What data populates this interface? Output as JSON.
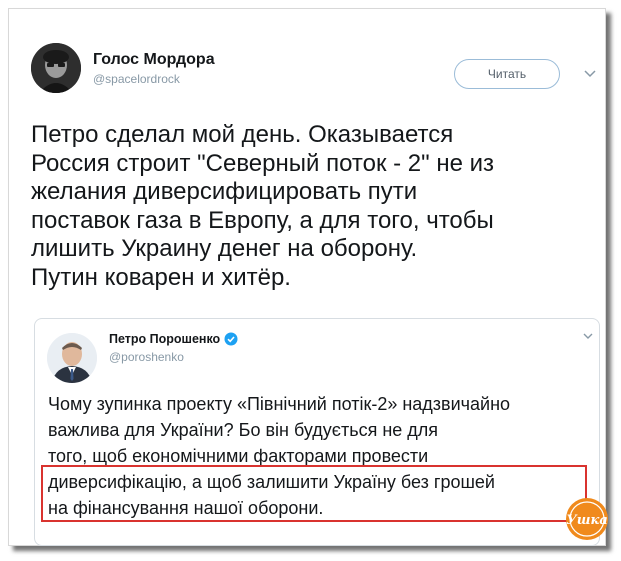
{
  "tweet": {
    "author_name": "Голос Мордора",
    "author_handle": "@spacelordrock",
    "follow_label": "Читать",
    "text": "Петро сделал мой день. Оказывается\nРоссия строит \"Северный поток - 2\" не из\nжелания диверсифицировать пути\nпоставок газа в Европу, а для того, чтобы\nлишить Украину денег на оборону.\nПутин коварен и хитёр."
  },
  "quoted_tweet": {
    "author_name": "Петро Порошенко",
    "author_handle": "@poroshenko",
    "verified": true,
    "text": "Чому зупинка проекту «Північний потік-2» надзвичайно\nважлива для України? Бо він будується не для\nтого, щоб економічними факторами провести\nдиверсифікацію, а щоб залишити Україну без грошей\nна фінансування нашої оборони."
  },
  "watermark": {
    "text": "Ушка",
    "color": "#f08a1c"
  },
  "colors": {
    "highlight": "#d9332f",
    "verified": "#1da1f2",
    "follow_border": "#9bbcd8",
    "muted_text": "#8899a6"
  }
}
